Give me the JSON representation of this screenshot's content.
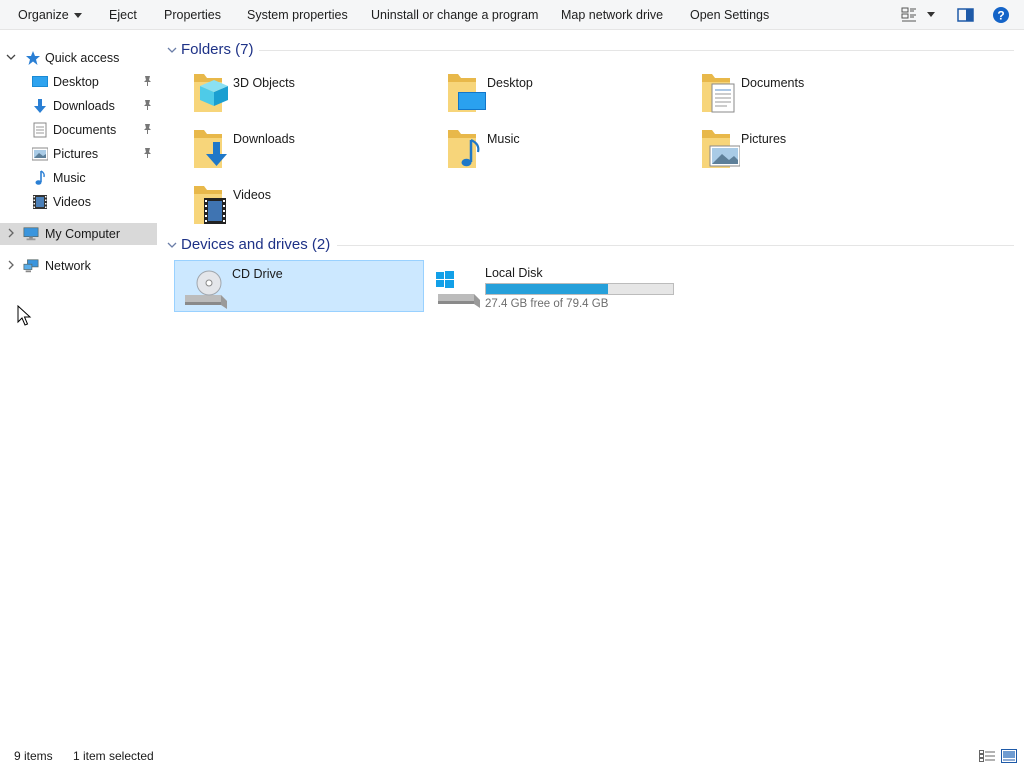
{
  "toolbar": {
    "organize": "Organize",
    "eject": "Eject",
    "properties": "Properties",
    "system_properties": "System properties",
    "uninstall": "Uninstall or change a program",
    "map_network_drive": "Map network drive",
    "open_settings": "Open Settings",
    "view_icon": "view-options-icon",
    "preview_pane_icon": "preview-pane-icon",
    "help_icon": "help-icon"
  },
  "nav": {
    "quick_access": "Quick access",
    "items": [
      {
        "label": "Desktop",
        "icon": "desktop-icon",
        "pinned": true
      },
      {
        "label": "Downloads",
        "icon": "downloads-icon",
        "pinned": true
      },
      {
        "label": "Documents",
        "icon": "documents-icon",
        "pinned": true
      },
      {
        "label": "Pictures",
        "icon": "pictures-icon",
        "pinned": true
      },
      {
        "label": "Music",
        "icon": "music-icon",
        "pinned": false
      },
      {
        "label": "Videos",
        "icon": "videos-icon",
        "pinned": false
      }
    ],
    "my_computer": "My Computer",
    "network": "Network"
  },
  "content": {
    "folders_header": "Folders (7)",
    "folders": [
      {
        "name": "3D Objects",
        "icon": "3d-objects-folder-icon"
      },
      {
        "name": "Desktop",
        "icon": "desktop-folder-icon"
      },
      {
        "name": "Documents",
        "icon": "documents-folder-icon"
      },
      {
        "name": "Downloads",
        "icon": "downloads-folder-icon"
      },
      {
        "name": "Music",
        "icon": "music-folder-icon"
      },
      {
        "name": "Pictures",
        "icon": "pictures-folder-icon"
      },
      {
        "name": "Videos",
        "icon": "videos-folder-icon"
      }
    ],
    "devices_header": "Devices and drives (2)",
    "drives": [
      {
        "name": "CD Drive",
        "icon": "cd-drive-icon",
        "selected": true
      },
      {
        "name": "Local Disk",
        "icon": "local-disk-icon",
        "free_text": "27.4 GB free of 79.4 GB",
        "used_fraction": 0.655
      }
    ]
  },
  "status": {
    "item_count": "9 items",
    "selection": "1 item selected"
  },
  "colors": {
    "accent": "#26a0da",
    "selection_bg": "#cce8ff",
    "group_title": "#1e3287"
  }
}
